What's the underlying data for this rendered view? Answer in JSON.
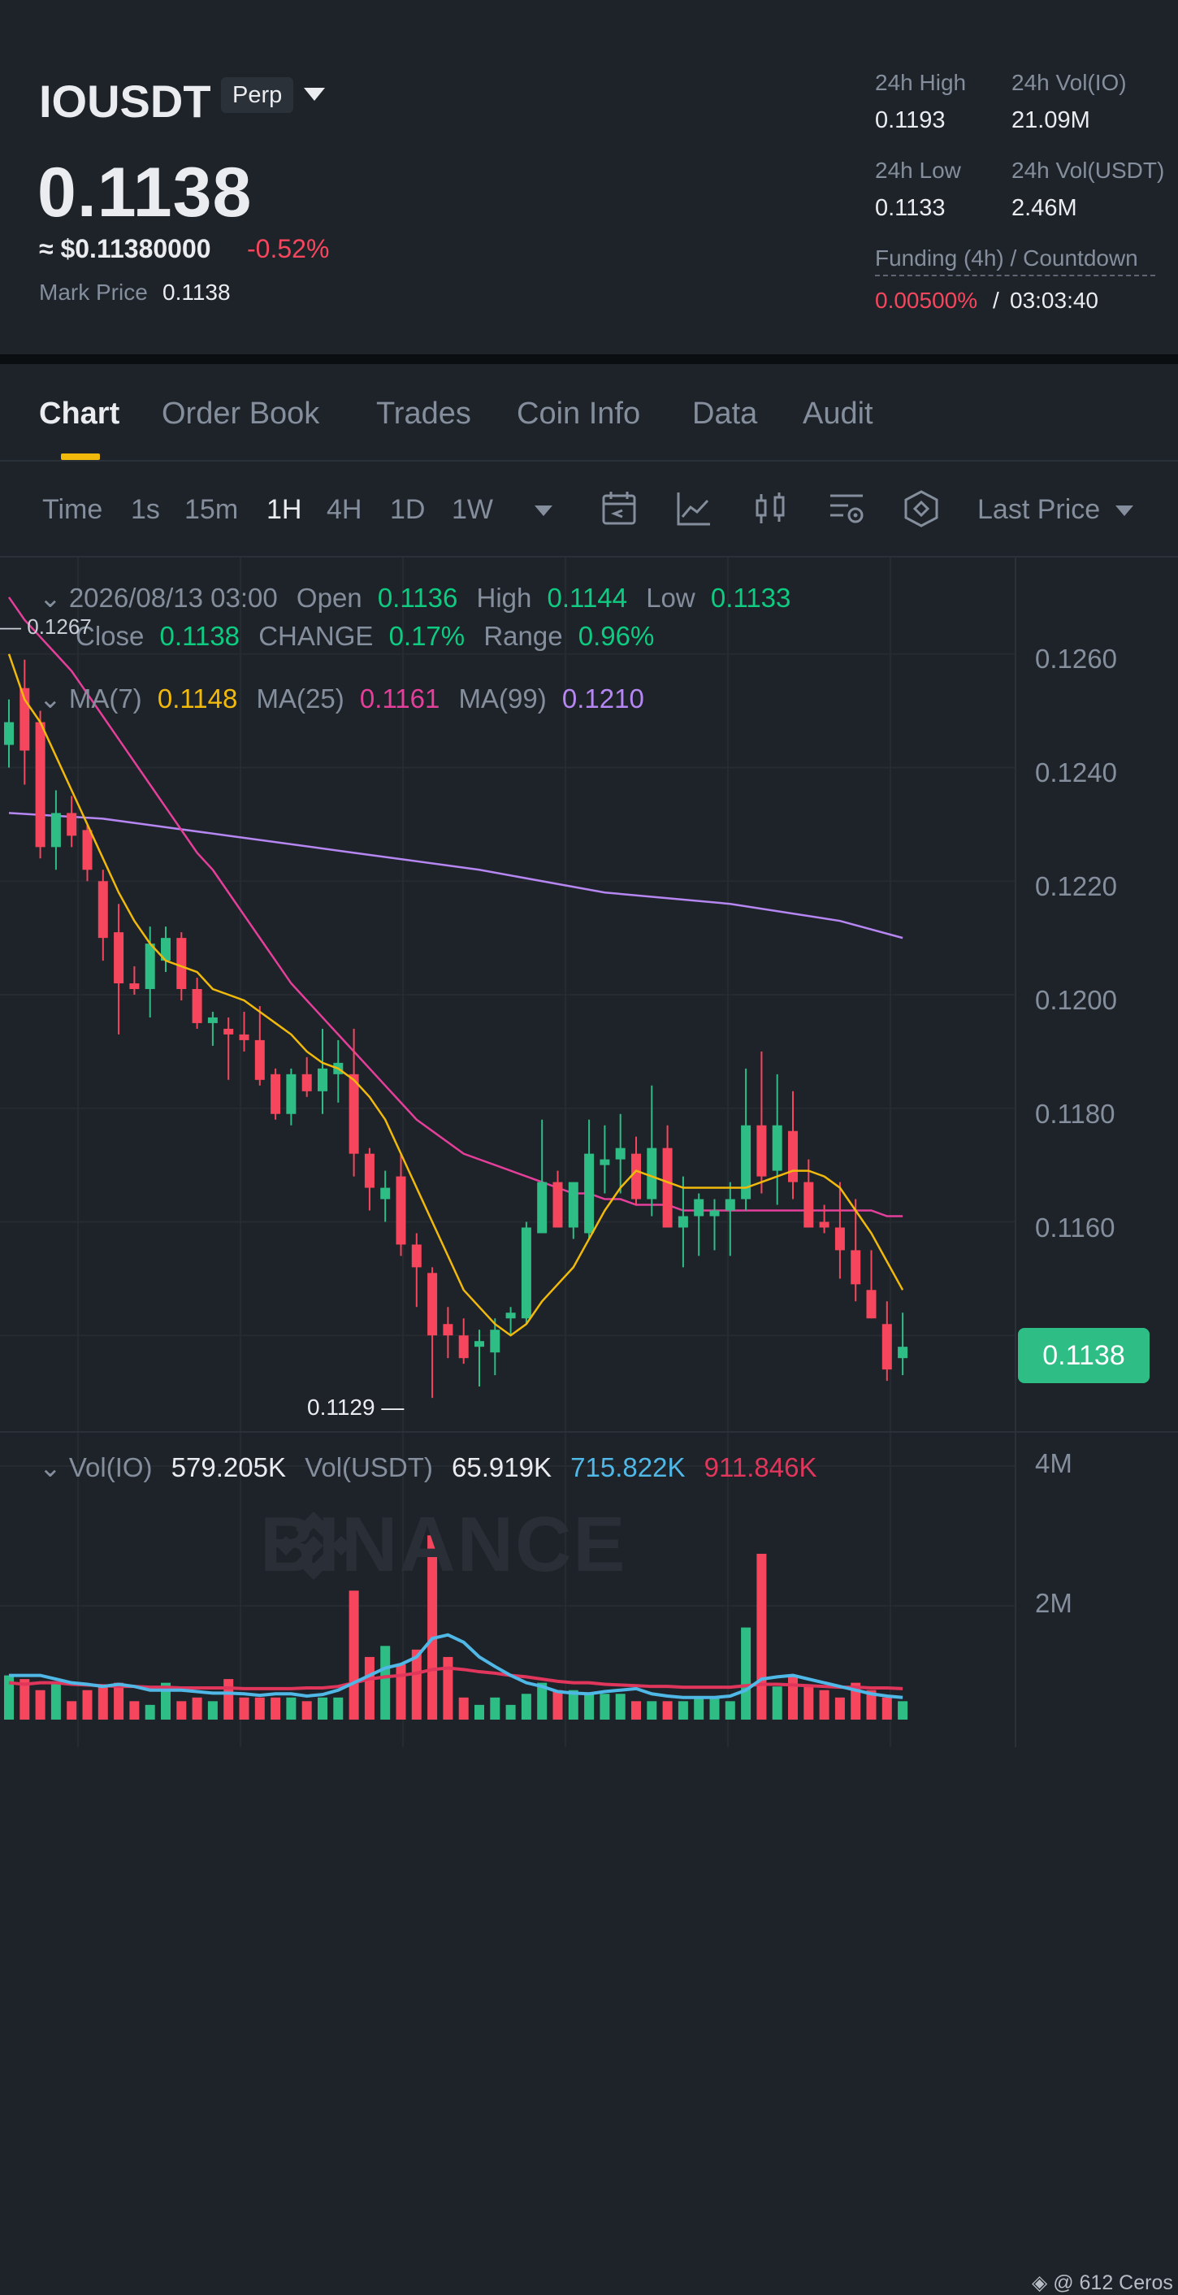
{
  "header": {
    "symbol": "IOUSDT",
    "contract_type": "Perp",
    "price": "0.1138",
    "usd_price": "≈ $0.11380000",
    "change_pct": "-0.52%",
    "mark_price_label": "Mark Price",
    "mark_price": "0.1138",
    "stats": {
      "high_label": "24h High",
      "high": "0.1193",
      "vol_io_label": "24h Vol(IO)",
      "vol_io": "21.09M",
      "low_label": "24h Low",
      "low": "0.1133",
      "vol_usdt_label": "24h Vol(USDT)",
      "vol_usdt": "2.46M",
      "funding_label": "Funding (4h) / Countdown",
      "funding_rate": "0.00500%",
      "funding_sep": "/",
      "countdown": "03:03:40"
    }
  },
  "tabs": [
    {
      "label": "Chart",
      "active": true
    },
    {
      "label": "Order Book"
    },
    {
      "label": "Trades"
    },
    {
      "label": "Coin Info"
    },
    {
      "label": "Data"
    },
    {
      "label": "Audit"
    }
  ],
  "toolbar": {
    "intervals": [
      "Time",
      "1s",
      "15m",
      "1H",
      "4H",
      "1D",
      "1W"
    ],
    "active_interval": "1H",
    "icons": [
      "calendar-icon",
      "indicator-icon",
      "candle-type-icon",
      "chart-settings-icon",
      "depth-icon"
    ],
    "price_type": "Last Price"
  },
  "ohlc": {
    "date": "2026/08/13 03:00",
    "open_label": "Open",
    "open": "0.1136",
    "high_label": "High",
    "high": "0.1144",
    "low_label": "Low",
    "low": "0.1133",
    "close_label": "Close",
    "close": "0.1138",
    "change_label": "CHANGE",
    "change": "0.17%",
    "range_label": "Range",
    "range": "0.96%"
  },
  "ma": {
    "ma7_label": "MA(7)",
    "ma7": "0.1148",
    "ma25_label": "MA(25)",
    "ma25": "0.1161",
    "ma99_label": "MA(99)",
    "ma99": "0.1210"
  },
  "annotations": {
    "high_marker": "0.1267",
    "low_marker": "0.1129"
  },
  "last_price_tag": "0.1138",
  "volume": {
    "label": "Vol(IO)",
    "vol_io": "579.205K",
    "usdt_label": "Vol(USDT)",
    "vol_usdt": "65.919K",
    "ma_a": "715.822K",
    "ma_b": "911.846K",
    "ticks": [
      "4M",
      "2M"
    ]
  },
  "watermark": "BINANCE",
  "footer": "@ 612 Ceros",
  "colors": {
    "up": "#2ebd85",
    "down": "#f6465d",
    "ma7": "#f0b90b",
    "ma25": "#e43f9a",
    "ma99": "#b687f2",
    "vol_ma_a": "#50b8e7",
    "vol_ma_b": "#e0365c",
    "accent": "#f0b90b"
  },
  "chart_data": {
    "type": "candlestick",
    "interval": "1H",
    "y_ticks": [
      "0.1260",
      "0.1240",
      "0.1220",
      "0.1200",
      "0.1180",
      "0.1160"
    ],
    "ylim": [
      0.1123,
      0.1277
    ],
    "candles": [
      [
        0.1244,
        0.1252,
        0.124,
        0.1248
      ],
      [
        0.1254,
        0.1259,
        0.1237,
        0.1243
      ],
      [
        0.1248,
        0.125,
        0.1224,
        0.1226
      ],
      [
        0.1226,
        0.1236,
        0.1222,
        0.1232
      ],
      [
        0.1232,
        0.1235,
        0.1226,
        0.1228
      ],
      [
        0.1229,
        0.123,
        0.122,
        0.1222
      ],
      [
        0.122,
        0.1222,
        0.1206,
        0.121
      ],
      [
        0.1211,
        0.1216,
        0.1193,
        0.1202
      ],
      [
        0.1202,
        0.1205,
        0.12,
        0.1201
      ],
      [
        0.1201,
        0.1212,
        0.1196,
        0.1209
      ],
      [
        0.1206,
        0.1212,
        0.1204,
        0.121
      ],
      [
        0.121,
        0.1211,
        0.1199,
        0.1201
      ],
      [
        0.1201,
        0.1203,
        0.1194,
        0.1195
      ],
      [
        0.1195,
        0.1197,
        0.1191,
        0.1196
      ],
      [
        0.1194,
        0.1196,
        0.1185,
        0.1193
      ],
      [
        0.1193,
        0.1197,
        0.119,
        0.1192
      ],
      [
        0.1192,
        0.1198,
        0.1184,
        0.1185
      ],
      [
        0.1186,
        0.1187,
        0.1178,
        0.1179
      ],
      [
        0.1179,
        0.1187,
        0.1177,
        0.1186
      ],
      [
        0.1186,
        0.1189,
        0.1182,
        0.1183
      ],
      [
        0.1183,
        0.1194,
        0.1179,
        0.1187
      ],
      [
        0.1186,
        0.1192,
        0.1181,
        0.1188
      ],
      [
        0.1186,
        0.1194,
        0.1168,
        0.1172
      ],
      [
        0.1172,
        0.1173,
        0.1162,
        0.1166
      ],
      [
        0.1164,
        0.1169,
        0.116,
        0.1166
      ],
      [
        0.1168,
        0.1172,
        0.1154,
        0.1156
      ],
      [
        0.1156,
        0.1158,
        0.1145,
        0.1152
      ],
      [
        0.1151,
        0.1152,
        0.1129,
        0.114
      ],
      [
        0.1142,
        0.1145,
        0.1136,
        0.114
      ],
      [
        0.114,
        0.1143,
        0.1135,
        0.1136
      ],
      [
        0.1138,
        0.1141,
        0.1131,
        0.1139
      ],
      [
        0.1137,
        0.1143,
        0.1133,
        0.1141
      ],
      [
        0.1143,
        0.1145,
        0.114,
        0.1144
      ],
      [
        0.1143,
        0.116,
        0.1142,
        0.1159
      ],
      [
        0.1158,
        0.1178,
        0.1158,
        0.1167
      ],
      [
        0.1167,
        0.1169,
        0.1159,
        0.1159
      ],
      [
        0.1159,
        0.1167,
        0.1157,
        0.1167
      ],
      [
        0.1158,
        0.1178,
        0.1157,
        0.1172
      ],
      [
        0.117,
        0.1177,
        0.1165,
        0.1171
      ],
      [
        0.1171,
        0.1179,
        0.1165,
        0.1173
      ],
      [
        0.1172,
        0.1175,
        0.1163,
        0.1164
      ],
      [
        0.1164,
        0.1184,
        0.1161,
        0.1173
      ],
      [
        0.1173,
        0.1177,
        0.1159,
        0.1159
      ],
      [
        0.1159,
        0.1168,
        0.1152,
        0.1161
      ],
      [
        0.1161,
        0.1165,
        0.1154,
        0.1164
      ],
      [
        0.1161,
        0.1164,
        0.1155,
        0.1162
      ],
      [
        0.1162,
        0.1167,
        0.1154,
        0.1164
      ],
      [
        0.1164,
        0.1187,
        0.1162,
        0.1177
      ],
      [
        0.1177,
        0.119,
        0.1165,
        0.1168
      ],
      [
        0.1169,
        0.1186,
        0.1163,
        0.1177
      ],
      [
        0.1176,
        0.1183,
        0.1164,
        0.1167
      ],
      [
        0.1167,
        0.1171,
        0.1159,
        0.1159
      ],
      [
        0.116,
        0.1163,
        0.1158,
        0.1159
      ],
      [
        0.1159,
        0.1167,
        0.115,
        0.1155
      ],
      [
        0.1155,
        0.1164,
        0.1146,
        0.1149
      ],
      [
        0.1148,
        0.1155,
        0.1143,
        0.1143
      ],
      [
        0.1142,
        0.1146,
        0.1132,
        0.1134
      ],
      [
        0.1136,
        0.1144,
        0.1133,
        0.1138
      ]
    ],
    "ma7": [
      0.126,
      0.1252,
      0.1248,
      0.1242,
      0.1236,
      0.123,
      0.1224,
      0.1218,
      0.1213,
      0.1209,
      0.1206,
      0.1205,
      0.1204,
      0.1201,
      0.12,
      0.1199,
      0.1197,
      0.1195,
      0.1193,
      0.119,
      0.1188,
      0.1187,
      0.1185,
      0.1182,
      0.1178,
      0.1172,
      0.1166,
      0.116,
      0.1154,
      0.1148,
      0.1145,
      0.1142,
      0.114,
      0.1142,
      0.1146,
      0.1149,
      0.1152,
      0.1157,
      0.1162,
      0.1166,
      0.1169,
      0.1168,
      0.1167,
      0.1166,
      0.1166,
      0.1166,
      0.1166,
      0.1166,
      0.1167,
      0.1168,
      0.1169,
      0.1169,
      0.1168,
      0.1166,
      0.1162,
      0.1158,
      0.1153,
      0.1148
    ],
    "ma25": [
      0.127,
      0.1266,
      0.1263,
      0.126,
      0.1257,
      0.1253,
      0.1249,
      0.1245,
      0.1241,
      0.1237,
      0.1233,
      0.1229,
      0.1225,
      0.1222,
      0.1218,
      0.1214,
      0.121,
      0.1206,
      0.1202,
      0.1199,
      0.1196,
      0.1193,
      0.119,
      0.1187,
      0.1184,
      0.1181,
      0.1178,
      0.1176,
      0.1174,
      0.1172,
      0.1171,
      0.117,
      0.1169,
      0.1168,
      0.1167,
      0.1166,
      0.1165,
      0.1165,
      0.1164,
      0.1164,
      0.1163,
      0.1163,
      0.1163,
      0.1162,
      0.1162,
      0.1162,
      0.1162,
      0.1162,
      0.1162,
      0.1162,
      0.1162,
      0.1162,
      0.1162,
      0.1162,
      0.1162,
      0.1162,
      0.1161,
      0.1161
    ],
    "ma99_points": [
      [
        0,
        0.1232
      ],
      [
        6,
        0.1231
      ],
      [
        14,
        0.1228
      ],
      [
        22,
        0.1225
      ],
      [
        30,
        0.1222
      ],
      [
        38,
        0.1218
      ],
      [
        46,
        0.1216
      ],
      [
        53,
        0.1213
      ],
      [
        57,
        0.121
      ]
    ],
    "volume": [
      0.6,
      0.55,
      0.4,
      0.5,
      0.25,
      0.4,
      0.45,
      0.5,
      0.25,
      0.2,
      0.5,
      0.25,
      0.3,
      0.25,
      0.55,
      0.3,
      0.3,
      0.3,
      0.3,
      0.25,
      0.3,
      0.3,
      1.75,
      0.85,
      1.0,
      0.75,
      0.95,
      2.5,
      0.85,
      0.3,
      0.2,
      0.3,
      0.2,
      0.35,
      0.5,
      0.4,
      0.4,
      0.35,
      0.35,
      0.35,
      0.25,
      0.25,
      0.25,
      0.25,
      0.3,
      0.3,
      0.25,
      1.25,
      2.25,
      0.45,
      0.6,
      0.45,
      0.4,
      0.3,
      0.5,
      0.4,
      0.3,
      0.25
    ],
    "vol_ma_a": [
      0.6,
      0.6,
      0.6,
      0.55,
      0.5,
      0.48,
      0.45,
      0.48,
      0.45,
      0.4,
      0.4,
      0.4,
      0.38,
      0.36,
      0.36,
      0.35,
      0.33,
      0.35,
      0.35,
      0.32,
      0.34,
      0.4,
      0.5,
      0.6,
      0.7,
      0.75,
      0.85,
      1.1,
      1.15,
      1.05,
      0.85,
      0.72,
      0.6,
      0.5,
      0.45,
      0.38,
      0.36,
      0.35,
      0.38,
      0.4,
      0.42,
      0.35,
      0.32,
      0.3,
      0.3,
      0.3,
      0.32,
      0.4,
      0.55,
      0.58,
      0.6,
      0.55,
      0.5,
      0.45,
      0.4,
      0.35,
      0.32,
      0.3
    ],
    "vol_ma_b": [
      0.5,
      0.48,
      0.5,
      0.5,
      0.48,
      0.47,
      0.46,
      0.45,
      0.45,
      0.44,
      0.44,
      0.43,
      0.43,
      0.43,
      0.43,
      0.42,
      0.42,
      0.42,
      0.42,
      0.43,
      0.43,
      0.45,
      0.5,
      0.55,
      0.58,
      0.6,
      0.63,
      0.68,
      0.7,
      0.68,
      0.65,
      0.63,
      0.6,
      0.58,
      0.55,
      0.52,
      0.5,
      0.5,
      0.48,
      0.47,
      0.46,
      0.45,
      0.45,
      0.44,
      0.44,
      0.44,
      0.44,
      0.46,
      0.48,
      0.48,
      0.47,
      0.46,
      0.45,
      0.44,
      0.44,
      0.43,
      0.43,
      0.42
    ],
    "vol_ylim_M": [
      0,
      4.3
    ]
  }
}
